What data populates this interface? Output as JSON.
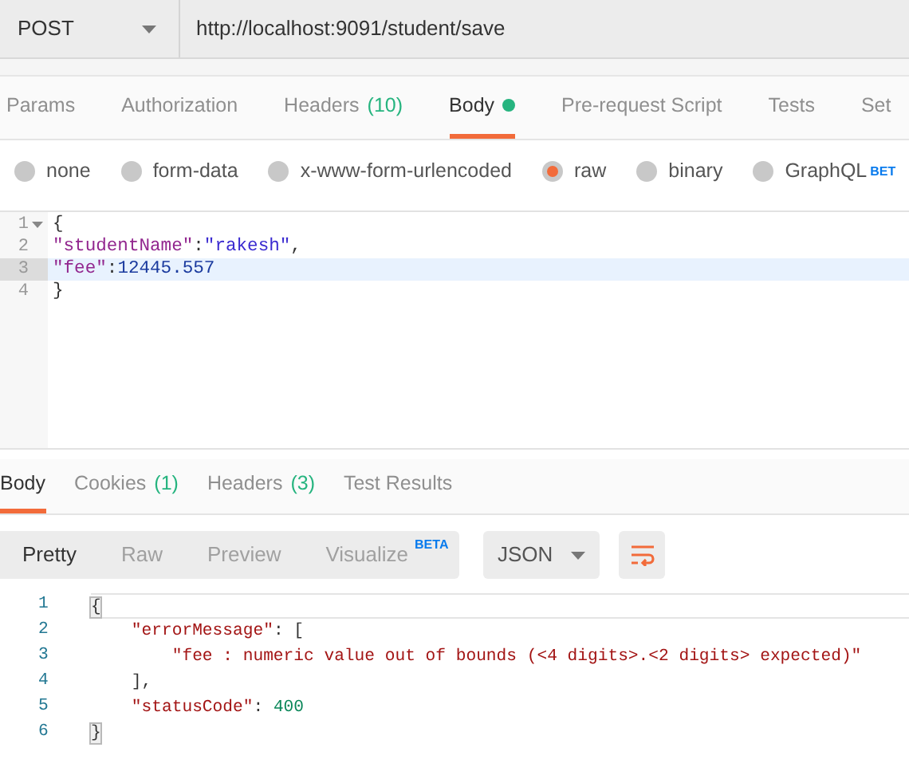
{
  "request": {
    "method": "POST",
    "url": "http://localhost:9091/student/save"
  },
  "request_tabs": [
    {
      "label": "Params",
      "selected": false
    },
    {
      "label": "Authorization",
      "selected": false
    },
    {
      "label": "Headers",
      "count": "(10)",
      "selected": false
    },
    {
      "label": "Body",
      "selected": true,
      "dot": true
    },
    {
      "label": "Pre-request Script",
      "selected": false
    },
    {
      "label": "Tests",
      "selected": false
    },
    {
      "label": "Set",
      "selected": false
    }
  ],
  "body_types": [
    {
      "label": "none",
      "selected": false
    },
    {
      "label": "form-data",
      "selected": false
    },
    {
      "label": "x-www-form-urlencoded",
      "selected": false
    },
    {
      "label": "raw",
      "selected": true
    },
    {
      "label": "binary",
      "selected": false
    },
    {
      "label": "GraphQL",
      "selected": false,
      "badge": "BET"
    }
  ],
  "request_body": {
    "lines": [
      {
        "number": "1",
        "fold": true,
        "active": false,
        "tokens": [
          {
            "kind": "punct",
            "text": "{"
          }
        ]
      },
      {
        "number": "2",
        "fold": false,
        "active": false,
        "tokens": [
          {
            "kind": "key",
            "text": "\"studentName\""
          },
          {
            "kind": "punct",
            "text": ":"
          },
          {
            "kind": "string",
            "text": "\"rakesh\""
          },
          {
            "kind": "punct",
            "text": ","
          }
        ]
      },
      {
        "number": "3",
        "fold": false,
        "active": true,
        "tokens": [
          {
            "kind": "key",
            "text": "\"fee\""
          },
          {
            "kind": "punct",
            "text": ":"
          },
          {
            "kind": "number",
            "text": "12445.557"
          }
        ]
      },
      {
        "number": "4",
        "fold": false,
        "active": false,
        "tokens": [
          {
            "kind": "punct",
            "text": "}"
          }
        ]
      }
    ]
  },
  "response_tabs": [
    {
      "label": "Body",
      "selected": true
    },
    {
      "label": "Cookies",
      "count": "(1)",
      "selected": false
    },
    {
      "label": "Headers",
      "count": "(3)",
      "selected": false
    },
    {
      "label": "Test Results",
      "selected": false
    }
  ],
  "view_modes": [
    {
      "label": "Pretty",
      "selected": true
    },
    {
      "label": "Raw",
      "selected": false
    },
    {
      "label": "Preview",
      "selected": false
    },
    {
      "label": "Visualize",
      "selected": false,
      "badge": "BETA"
    }
  ],
  "format": "JSON",
  "response_body": {
    "lines": [
      {
        "number": "1",
        "tokens": [
          {
            "kind": "punct",
            "text": "{",
            "matched": true
          }
        ]
      },
      {
        "number": "2",
        "tokens": [
          {
            "kind": "key",
            "text": "    \"errorMessage\""
          },
          {
            "kind": "punct",
            "text": ": ["
          }
        ]
      },
      {
        "number": "3",
        "tokens": [
          {
            "kind": "string",
            "text": "        \"fee : numeric value out of bounds (<4 digits>.<2 digits> expected)\""
          }
        ]
      },
      {
        "number": "4",
        "tokens": [
          {
            "kind": "punct",
            "text": "    ],"
          }
        ]
      },
      {
        "number": "5",
        "tokens": [
          {
            "kind": "key",
            "text": "    \"statusCode\""
          },
          {
            "kind": "punct",
            "text": ": "
          },
          {
            "kind": "number",
            "text": "400"
          }
        ]
      },
      {
        "number": "6",
        "tokens": [
          {
            "kind": "punct",
            "text": "}",
            "matched": true
          }
        ]
      }
    ]
  }
}
